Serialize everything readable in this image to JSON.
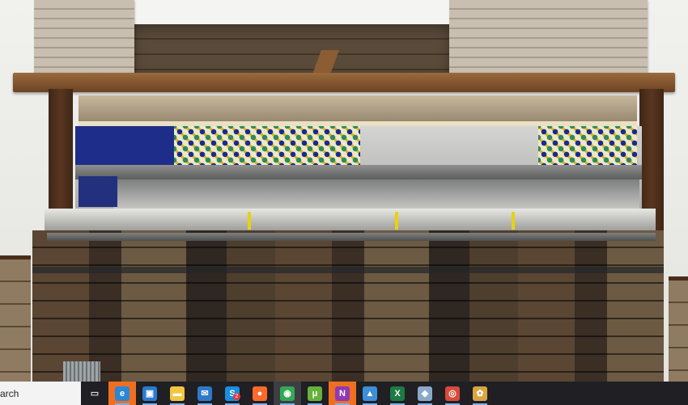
{
  "taskbar": {
    "search_text": "arch",
    "icons": [
      {
        "name": "task-view-icon",
        "glyph": "▭"
      },
      {
        "name": "edge-icon",
        "glyph": "e",
        "color": "#2b87d3"
      },
      {
        "name": "store-icon",
        "glyph": "▣",
        "color": "#2a7ad0"
      },
      {
        "name": "file-explorer-icon",
        "glyph": "▬",
        "color": "#f2c641"
      },
      {
        "name": "mail-icon",
        "glyph": "✉",
        "color": "#2f79c8"
      },
      {
        "name": "skype-icon",
        "glyph": "S",
        "color": "#1a8ee0",
        "badge": "2"
      },
      {
        "name": "firefox-icon",
        "glyph": "●",
        "color": "#ff6a2a"
      },
      {
        "name": "chrome-icon",
        "glyph": "◉",
        "color": "#34a853"
      },
      {
        "name": "utorrent-icon",
        "glyph": "μ",
        "color": "#66b23a"
      },
      {
        "name": "onenote-icon",
        "glyph": "N",
        "color": "#8e3ab2"
      },
      {
        "name": "photos-icon",
        "glyph": "▲",
        "color": "#3c8fd9"
      },
      {
        "name": "excel-icon",
        "glyph": "X",
        "color": "#1d7a42"
      },
      {
        "name": "app-icon",
        "glyph": "◆",
        "color": "#8aa9c8"
      },
      {
        "name": "record-icon",
        "glyph": "◎",
        "color": "#d84a3a"
      },
      {
        "name": "paint-icon",
        "glyph": "✿",
        "color": "#d9a441"
      }
    ]
  }
}
